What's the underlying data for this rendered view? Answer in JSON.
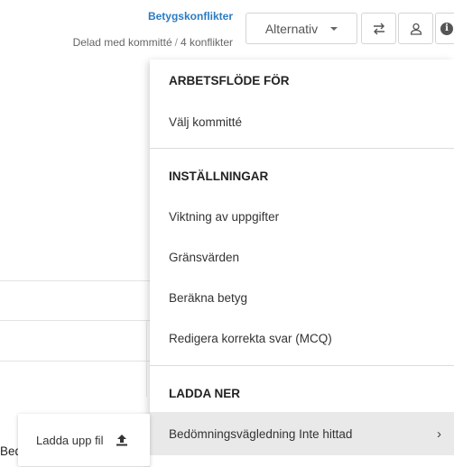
{
  "header": {
    "conflict_link": "Betygskonflikter",
    "shared_label": "Delad med kommitté",
    "separator": "/",
    "conflict_count": "4 konflikter"
  },
  "toolbar": {
    "options_label": "Alternativ",
    "icons": [
      "swap-icon",
      "user-icon",
      "info-icon"
    ]
  },
  "menu": {
    "section1": {
      "heading": "ARBETSFLÖDE FÖR",
      "items": [
        "Välj kommitté"
      ]
    },
    "section2": {
      "heading": "INSTÄLLNINGAR",
      "items": [
        "Viktning av uppgifter",
        "Gränsvärden",
        "Beräkna betyg",
        "Redigera korrekta svar (MCQ)"
      ]
    },
    "section3": {
      "heading": "LADDA NER",
      "items": [
        "Bedömningsvägledning Inte hittad"
      ]
    }
  },
  "upload": {
    "label": "Ladda upp fil"
  },
  "background": {
    "partial_text": "Bed"
  }
}
